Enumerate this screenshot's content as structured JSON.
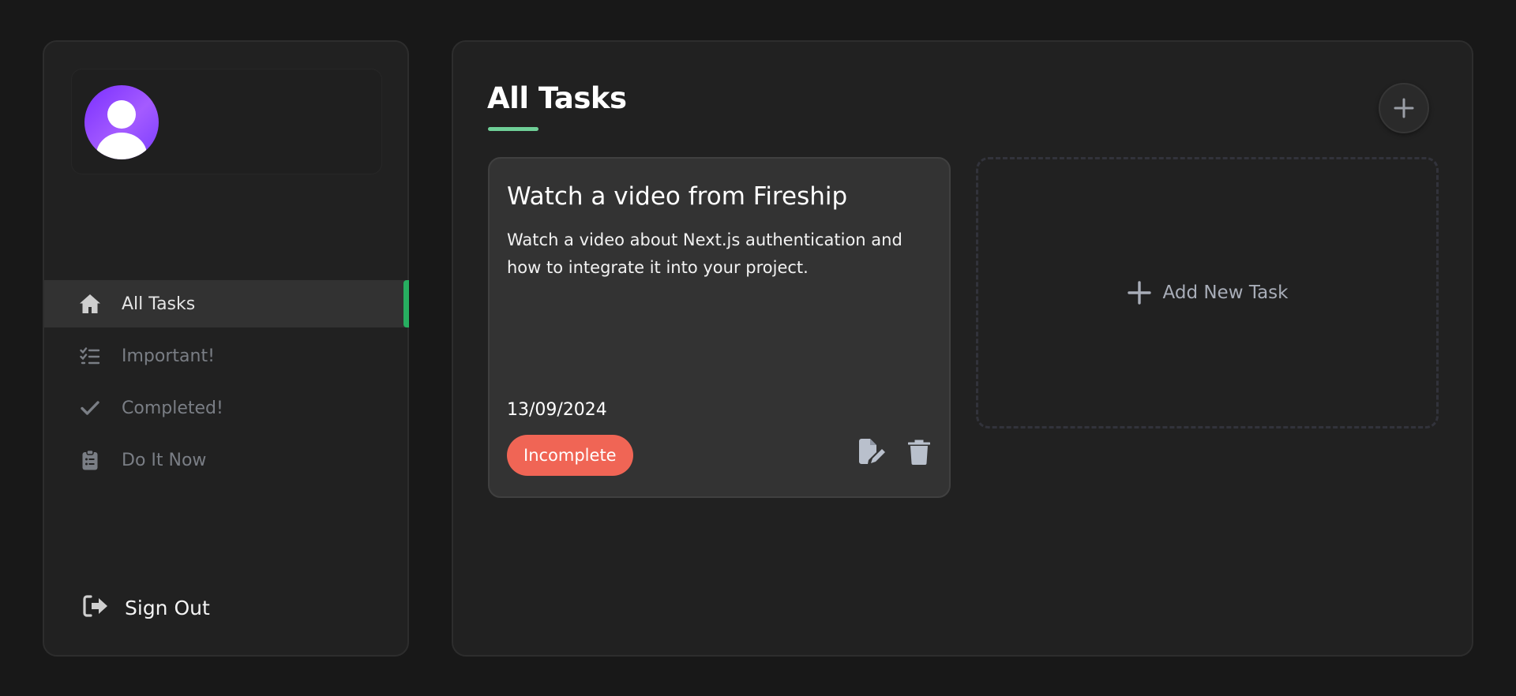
{
  "sidebar": {
    "avatar_icon": "user-avatar",
    "nav": [
      {
        "label": "All Tasks",
        "icon": "home-icon",
        "active": true
      },
      {
        "label": "Important!",
        "icon": "list-check-icon",
        "active": false
      },
      {
        "label": "Completed!",
        "icon": "check-icon",
        "active": false
      },
      {
        "label": "Do It Now",
        "icon": "clipboard-icon",
        "active": false
      }
    ],
    "signout_label": "Sign Out"
  },
  "main": {
    "title": "All Tasks",
    "add_button_icon": "plus-icon",
    "tasks": [
      {
        "title": "Watch a video from Fireship",
        "description": "Watch a video about Next.js authentication and how to integrate it into your project.",
        "date": "13/09/2024",
        "status": "Incomplete"
      }
    ],
    "add_task_label": "Add New Task"
  },
  "colors": {
    "background": "#181818",
    "panel": "#212121",
    "card": "#333333",
    "accent_green": "#27ae60",
    "title_underline": "#6fcf97",
    "incomplete_red": "#f06555"
  }
}
